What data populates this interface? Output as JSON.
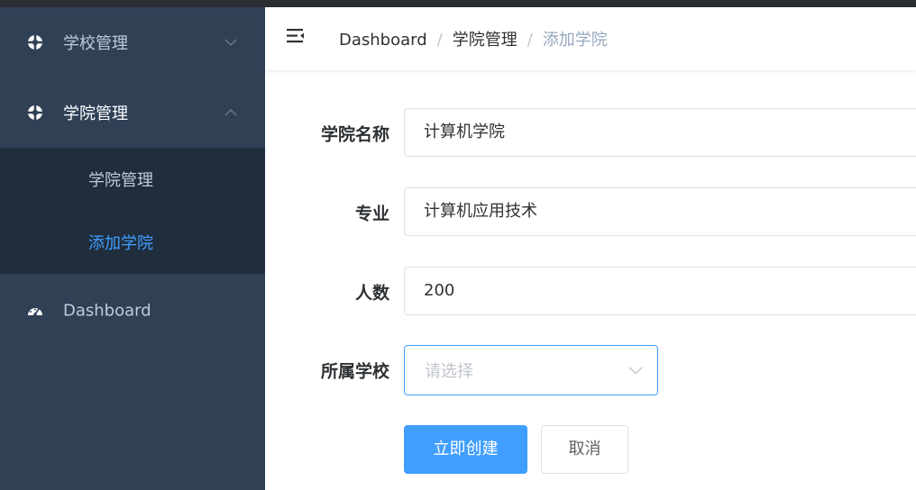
{
  "sidebar": {
    "menus": [
      {
        "label": "学校管理",
        "icon": "lifebuoy-icon",
        "expanded": false
      },
      {
        "label": "学院管理",
        "icon": "lifebuoy-icon",
        "expanded": true
      },
      {
        "label": "Dashboard",
        "icon": "dashboard-gauge-icon"
      }
    ],
    "submenu": [
      {
        "label": "学院管理",
        "selected": false
      },
      {
        "label": "添加学院",
        "selected": true
      }
    ]
  },
  "navbar": {
    "breadcrumb": [
      "Dashboard",
      "学院管理",
      "添加学院"
    ],
    "separator": "/"
  },
  "form": {
    "college_name": {
      "label": "学院名称",
      "value": "计算机学院"
    },
    "major": {
      "label": "专业",
      "value": "计算机应用技术"
    },
    "count": {
      "label": "人数",
      "value": "200"
    },
    "school": {
      "label": "所属学校",
      "placeholder": "请选择"
    },
    "submit_label": "立即创建",
    "cancel_label": "取消"
  },
  "colors": {
    "sidebar_bg": "#304156",
    "submenu_bg": "#1f2d3d",
    "accent": "#409eff",
    "sidebar_text": "#bfcbd9"
  }
}
